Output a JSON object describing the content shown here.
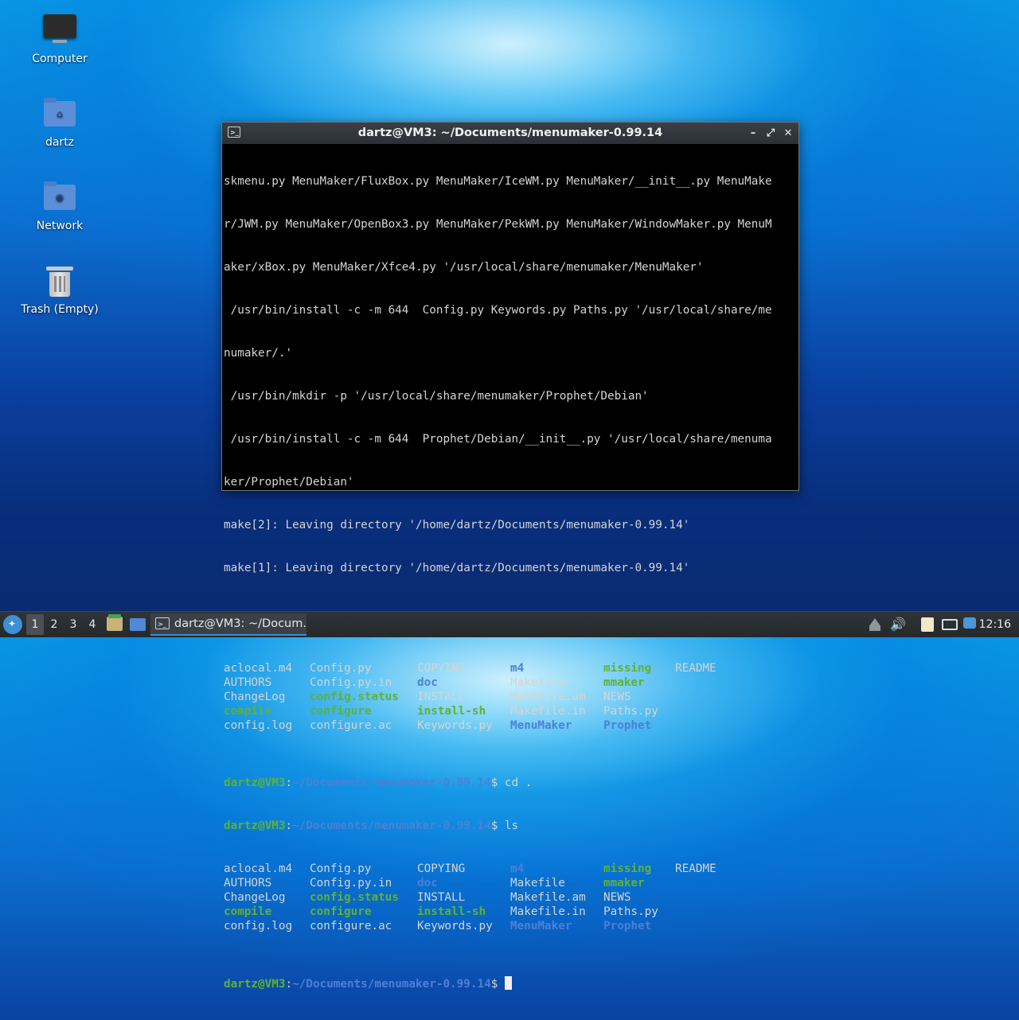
{
  "desktop": {
    "icons": [
      {
        "label": "Computer",
        "icon": "computer-icon"
      },
      {
        "label": "dartz",
        "icon": "home-folder-icon"
      },
      {
        "label": "Network",
        "icon": "network-folder-icon"
      },
      {
        "label": "Trash (Empty)",
        "icon": "trash-icon"
      }
    ]
  },
  "window": {
    "title": "dartz@VM3: ~/Documents/menumaker-0.99.14",
    "controls": {
      "minimize": "–",
      "maximize": "⤢",
      "close": "✕"
    }
  },
  "terminal": {
    "output_lines": [
      "skmenu.py MenuMaker/FluxBox.py MenuMaker/IceWM.py MenuMaker/__init__.py MenuMake",
      "r/JWM.py MenuMaker/OpenBox3.py MenuMaker/PekWM.py MenuMaker/WindowMaker.py MenuM",
      "aker/xBox.py MenuMaker/Xfce4.py '/usr/local/share/menumaker/MenuMaker'",
      " /usr/bin/install -c -m 644  Config.py Keywords.py Paths.py '/usr/local/share/me",
      "numaker/.'",
      " /usr/bin/mkdir -p '/usr/local/share/menumaker/Prophet/Debian'",
      " /usr/bin/install -c -m 644  Prophet/Debian/__init__.py '/usr/local/share/menuma",
      "ker/Prophet/Debian'",
      "make[2]: Leaving directory '/home/dartz/Documents/menumaker-0.99.14'",
      "make[1]: Leaving directory '/home/dartz/Documents/menumaker-0.99.14'"
    ],
    "prompt_user": "dartz@VM3",
    "prompt_sep": ":",
    "prompt_path": "~/Documents/menumaker-0.99.14",
    "prompt_end": "$",
    "commands": [
      " ls",
      " cd .",
      " ls",
      " "
    ],
    "ls_rows": [
      [
        "aclocal.m4",
        "Config.py",
        "COPYING",
        "m4",
        "missing",
        "README"
      ],
      [
        "AUTHORS",
        "Config.py.in",
        "doc",
        "Makefile",
        "mmaker",
        ""
      ],
      [
        "ChangeLog",
        "config.status",
        "INSTALL",
        "Makefile.am",
        "NEWS",
        ""
      ],
      [
        "compile",
        "configure",
        "install-sh",
        "Makefile.in",
        "Paths.py",
        ""
      ],
      [
        "config.log",
        "configure.ac",
        "Keywords.py",
        "MenuMaker",
        "Prophet",
        ""
      ]
    ],
    "ls_colors": [
      [
        "",
        "",
        "",
        "blu",
        "grn",
        ""
      ],
      [
        "",
        "",
        "blu",
        "",
        "grn",
        ""
      ],
      [
        "",
        "grn",
        "",
        "",
        "",
        ""
      ],
      [
        "grn",
        "grn",
        "grn",
        "",
        "",
        ""
      ],
      [
        "",
        "",
        "",
        "blu",
        "blu",
        ""
      ]
    ]
  },
  "taskbar": {
    "workspaces": [
      "1",
      "2",
      "3",
      "4"
    ],
    "active_workspace": "1",
    "task_label": "dartz@VM3: ~/Docum...",
    "clock": "12:16"
  },
  "colors": {
    "prompt_user": "#5fb233",
    "prompt_path": "#4f7fd6",
    "accent": "#3b8cd8"
  }
}
